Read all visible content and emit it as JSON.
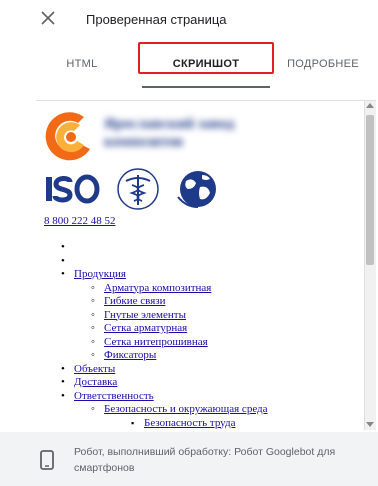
{
  "header": {
    "title": "Проверенная страница"
  },
  "tabs": [
    {
      "label": "HTML"
    },
    {
      "label": "СКРИНШОТ"
    },
    {
      "label": "ПОДРОБНЕЕ"
    }
  ],
  "screenshot": {
    "company_name_line1": "Ярославский завод",
    "company_name_line2": "композитов",
    "phone": "8 800 222 48 52",
    "menu": {
      "products": "Продукция",
      "products_sub": [
        "Арматура композитная",
        "Гибкие связи",
        "Гнутые элементы",
        "Сетка арматурная",
        "Сетка нитепрошивная",
        "Фиксаторы"
      ],
      "objects": "Объекты",
      "delivery": "Доставка",
      "responsibility": "Ответственность",
      "responsibility_sub": "Безопасность и окружающая среда",
      "responsibility_sub2": "Безопасность труда"
    }
  },
  "footer": {
    "text": "Робот, выполнивший обработку: Робот Googlebot для смартфонов"
  },
  "colors": {
    "highlight": "#e31e24",
    "link": "#1a0dab",
    "footer_bg": "#f1f3f4"
  }
}
